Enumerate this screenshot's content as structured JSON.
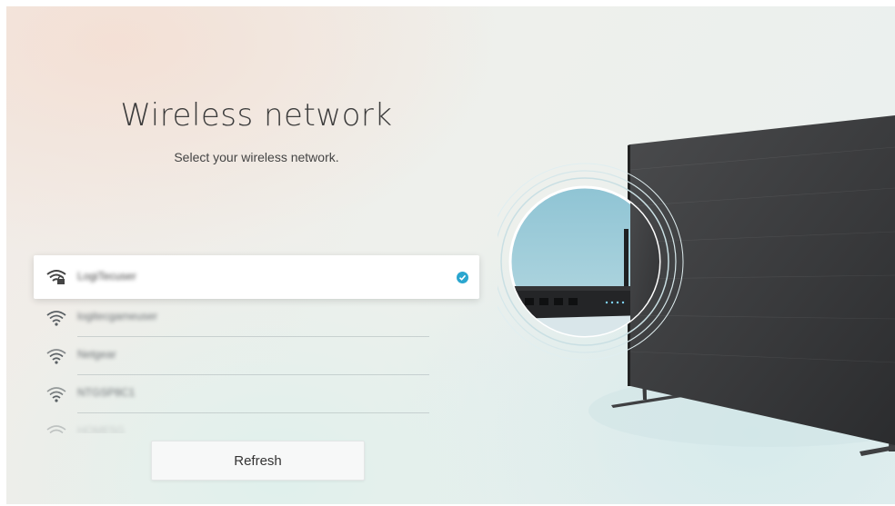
{
  "header": {
    "title": "Wireless network",
    "subtitle": "Select your wireless network."
  },
  "networks": [
    {
      "name": "LogiTecuser",
      "selected": true,
      "icon": "wifi-lock-icon"
    },
    {
      "name": "logitecgameuser",
      "selected": false,
      "icon": "wifi-icon"
    },
    {
      "name": "Netgear",
      "selected": false,
      "icon": "wifi-icon"
    },
    {
      "name": "NTGSP8C1",
      "selected": false,
      "icon": "wifi-icon"
    },
    {
      "name": "HOME5G",
      "selected": false,
      "icon": "wifi-icon"
    }
  ],
  "buttons": {
    "refresh_label": "Refresh"
  },
  "colors": {
    "accent": "#2aa6cf",
    "selected_bg": "#ffffff",
    "text": "#3c3c3c"
  },
  "illustration": {
    "icons": [
      "tv-icon",
      "router-icon"
    ]
  }
}
